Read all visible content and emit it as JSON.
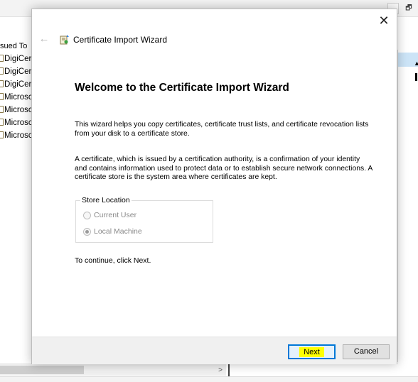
{
  "background_window": {
    "column_header": "sued To",
    "rows": [
      "DigiCert",
      "DigiCert",
      "DigiCert",
      "Microsc",
      "Microsc",
      "Microsc",
      "Microsc"
    ],
    "restore_glyph": "🗗",
    "scroll_right_glyph": ">"
  },
  "wizard": {
    "title": "Certificate Import Wizard",
    "close_glyph": "✕",
    "back_glyph": "←",
    "icon": "certificate-icon",
    "heading": "Welcome to the Certificate Import Wizard",
    "paragraph1": "This wizard helps you copy certificates, certificate trust lists, and certificate revocation lists from your disk to a certificate store.",
    "paragraph2": "A certificate, which is issued by a certification authority, is a confirmation of your identity and contains information used to protect data or to establish secure network connections. A certificate store is the system area where certificates are kept.",
    "store_location": {
      "legend": "Store Location",
      "options": [
        {
          "label": "Current User",
          "selected": false,
          "disabled": true
        },
        {
          "label": "Local Machine",
          "selected": true,
          "disabled": true
        }
      ]
    },
    "continue_text": "To continue, click Next.",
    "buttons": {
      "next": "Next",
      "cancel": "Cancel"
    }
  },
  "colors": {
    "accent": "#0078d7",
    "highlight": "#ffff00",
    "footer_bg": "#f0f0f0",
    "disabled_text": "#8a8a8a"
  }
}
